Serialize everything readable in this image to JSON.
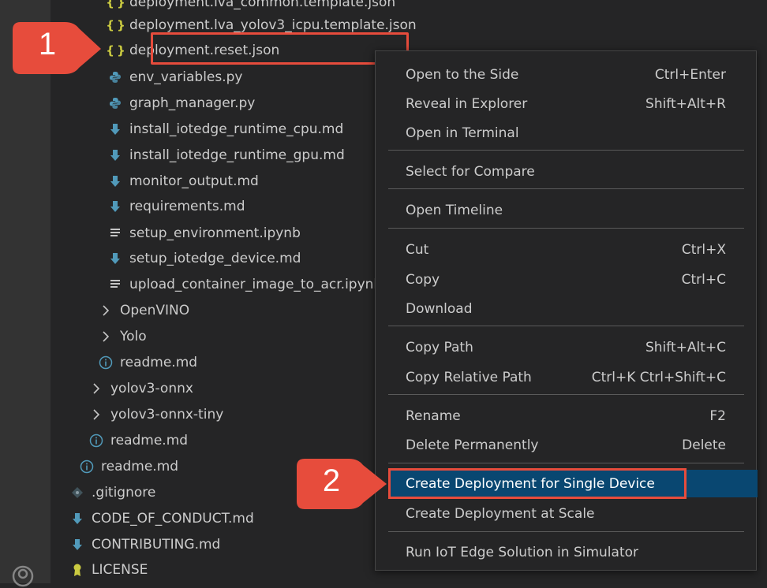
{
  "explorer": {
    "items": [
      {
        "label": "deployment.lva_common.template.json",
        "icon": "json-icon"
      },
      {
        "label": "deployment.lva_yolov3_icpu.template.json",
        "icon": "json-icon"
      },
      {
        "label": "deployment.reset.json",
        "icon": "json-icon"
      },
      {
        "label": "env_variables.py",
        "icon": "python-icon"
      },
      {
        "label": "graph_manager.py",
        "icon": "python-icon"
      },
      {
        "label": "install_iotedge_runtime_cpu.md",
        "icon": "markdown-icon"
      },
      {
        "label": "install_iotedge_runtime_gpu.md",
        "icon": "markdown-icon"
      },
      {
        "label": "monitor_output.md",
        "icon": "markdown-icon"
      },
      {
        "label": "requirements.md",
        "icon": "markdown-icon"
      },
      {
        "label": "setup_environment.ipynb",
        "icon": "notebook-icon"
      },
      {
        "label": "setup_iotedge_device.md",
        "icon": "markdown-icon"
      },
      {
        "label": "upload_container_image_to_acr.ipynb",
        "icon": "notebook-icon"
      },
      {
        "label": "OpenVINO",
        "icon": "chevron-right-icon"
      },
      {
        "label": "Yolo",
        "icon": "chevron-right-icon"
      },
      {
        "label": "readme.md",
        "icon": "info-icon"
      },
      {
        "label": "yolov3-onnx",
        "icon": "chevron-right-icon"
      },
      {
        "label": "yolov3-onnx-tiny",
        "icon": "chevron-right-icon"
      },
      {
        "label": "readme.md",
        "icon": "info-icon"
      },
      {
        "label": "readme.md",
        "icon": "info-icon"
      },
      {
        "label": ".gitignore",
        "icon": "git-icon"
      },
      {
        "label": "CODE_OF_CONDUCT.md",
        "icon": "markdown-icon"
      },
      {
        "label": "CONTRIBUTING.md",
        "icon": "markdown-icon"
      },
      {
        "label": "LICENSE",
        "icon": "license-icon"
      }
    ]
  },
  "context_menu": {
    "items": [
      {
        "label": "Open to the Side",
        "shortcut": "Ctrl+Enter"
      },
      {
        "label": "Reveal in Explorer",
        "shortcut": "Shift+Alt+R"
      },
      {
        "label": "Open in Terminal",
        "shortcut": ""
      },
      {
        "label": "Select for Compare",
        "shortcut": ""
      },
      {
        "label": "Open Timeline",
        "shortcut": ""
      },
      {
        "label": "Cut",
        "shortcut": "Ctrl+X"
      },
      {
        "label": "Copy",
        "shortcut": "Ctrl+C"
      },
      {
        "label": "Download",
        "shortcut": ""
      },
      {
        "label": "Copy Path",
        "shortcut": "Shift+Alt+C"
      },
      {
        "label": "Copy Relative Path",
        "shortcut": "Ctrl+K Ctrl+Shift+C"
      },
      {
        "label": "Rename",
        "shortcut": "F2"
      },
      {
        "label": "Delete Permanently",
        "shortcut": "Delete"
      },
      {
        "label": "Create Deployment for Single Device",
        "shortcut": ""
      },
      {
        "label": "Create Deployment at Scale",
        "shortcut": ""
      },
      {
        "label": "Run IoT Edge Solution in Simulator",
        "shortcut": ""
      }
    ]
  },
  "callouts": {
    "one": "1",
    "two": "2"
  },
  "colors": {
    "callout": "#e74c3c",
    "selection": "#094771",
    "json": "#cbcb41",
    "python": "#519aba",
    "markdown": "#519aba"
  }
}
